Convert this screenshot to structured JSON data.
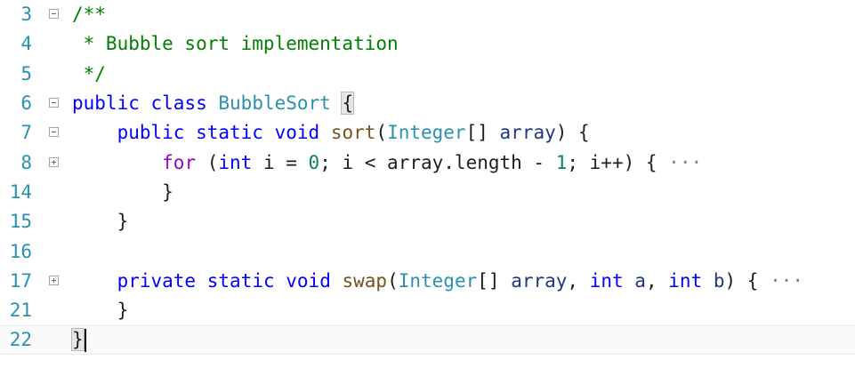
{
  "editor": {
    "lines": [
      {
        "num": "3",
        "fold": "minus",
        "tokens": [
          {
            "t": "/**",
            "c": "cm"
          }
        ]
      },
      {
        "num": "4",
        "fold": "",
        "tokens": [
          {
            "t": " * Bubble sort implementation",
            "c": "cm"
          }
        ]
      },
      {
        "num": "5",
        "fold": "",
        "tokens": [
          {
            "t": " */",
            "c": "cm"
          }
        ]
      },
      {
        "num": "6",
        "fold": "minus",
        "tokens": [
          {
            "t": "public",
            "c": "kw"
          },
          {
            "t": " ",
            "c": "op"
          },
          {
            "t": "class",
            "c": "kw"
          },
          {
            "t": " ",
            "c": "op"
          },
          {
            "t": "BubbleSort",
            "c": "ty"
          },
          {
            "t": " ",
            "c": "op"
          },
          {
            "t": "{",
            "c": "op brace-hl"
          }
        ]
      },
      {
        "num": "7",
        "fold": "minus",
        "tokens": [
          {
            "t": "    ",
            "c": "op"
          },
          {
            "t": "public",
            "c": "kw"
          },
          {
            "t": " ",
            "c": "op"
          },
          {
            "t": "static",
            "c": "kw"
          },
          {
            "t": " ",
            "c": "op"
          },
          {
            "t": "void",
            "c": "kw"
          },
          {
            "t": " ",
            "c": "op"
          },
          {
            "t": "sort",
            "c": "fn"
          },
          {
            "t": "(",
            "c": "op"
          },
          {
            "t": "Integer",
            "c": "ty"
          },
          {
            "t": "[] ",
            "c": "op"
          },
          {
            "t": "array",
            "c": "id"
          },
          {
            "t": ") {",
            "c": "op"
          }
        ]
      },
      {
        "num": "8",
        "fold": "plus",
        "tokens": [
          {
            "t": "        ",
            "c": "op"
          },
          {
            "t": "for",
            "c": "ctl"
          },
          {
            "t": " (",
            "c": "op"
          },
          {
            "t": "int",
            "c": "kw"
          },
          {
            "t": " i = ",
            "c": "op"
          },
          {
            "t": "0",
            "c": "num"
          },
          {
            "t": "; i < array.length - ",
            "c": "op"
          },
          {
            "t": "1",
            "c": "num"
          },
          {
            "t": "; i++) { ",
            "c": "op"
          },
          {
            "t": "···",
            "c": "ell"
          }
        ]
      },
      {
        "num": "14",
        "fold": "",
        "tokens": [
          {
            "t": "        }",
            "c": "op"
          }
        ]
      },
      {
        "num": "15",
        "fold": "",
        "tokens": [
          {
            "t": "    }",
            "c": "op"
          }
        ]
      },
      {
        "num": "16",
        "fold": "",
        "tokens": []
      },
      {
        "num": "17",
        "fold": "plus",
        "tokens": [
          {
            "t": "    ",
            "c": "op"
          },
          {
            "t": "private",
            "c": "kw"
          },
          {
            "t": " ",
            "c": "op"
          },
          {
            "t": "static",
            "c": "kw"
          },
          {
            "t": " ",
            "c": "op"
          },
          {
            "t": "void",
            "c": "kw"
          },
          {
            "t": " ",
            "c": "op"
          },
          {
            "t": "swap",
            "c": "fn"
          },
          {
            "t": "(",
            "c": "op"
          },
          {
            "t": "Integer",
            "c": "ty"
          },
          {
            "t": "[] ",
            "c": "op"
          },
          {
            "t": "array",
            "c": "id"
          },
          {
            "t": ", ",
            "c": "op"
          },
          {
            "t": "int",
            "c": "kw"
          },
          {
            "t": " ",
            "c": "op"
          },
          {
            "t": "a",
            "c": "id"
          },
          {
            "t": ", ",
            "c": "op"
          },
          {
            "t": "int",
            "c": "kw"
          },
          {
            "t": " ",
            "c": "op"
          },
          {
            "t": "b",
            "c": "id"
          },
          {
            "t": ") { ",
            "c": "op"
          },
          {
            "t": "···",
            "c": "ell"
          }
        ]
      },
      {
        "num": "21",
        "fold": "",
        "tokens": [
          {
            "t": "    }",
            "c": "op"
          }
        ]
      },
      {
        "num": "22",
        "fold": "",
        "current": true,
        "tokens": [
          {
            "t": "}",
            "c": "op brace-hl"
          }
        ]
      }
    ]
  }
}
